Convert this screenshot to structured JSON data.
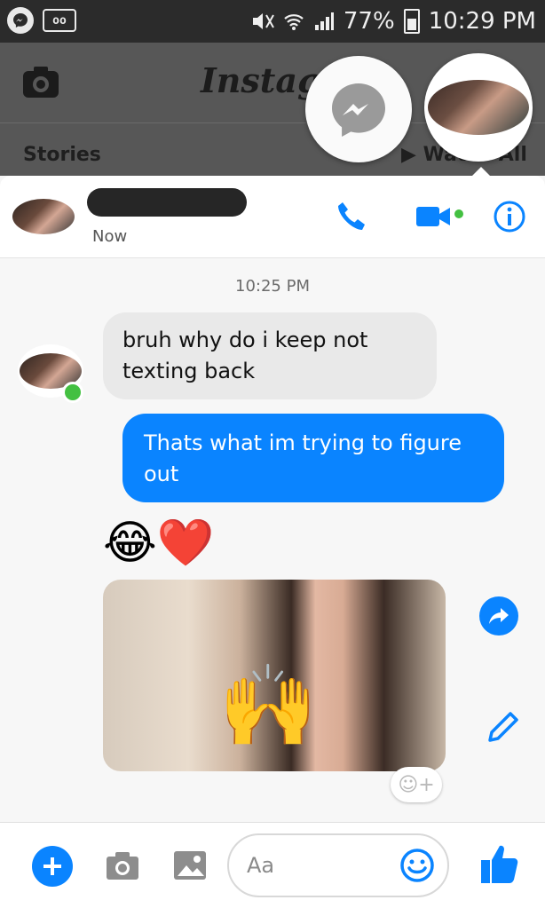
{
  "status_bar": {
    "voicemail_label": "oo",
    "battery": "77%",
    "time": "10:29 PM"
  },
  "instagram_bg": {
    "logo": "Instagram",
    "stories_label": "Stories",
    "watch_all_label": "Watch All"
  },
  "chat_header": {
    "status": "Now"
  },
  "conversation": {
    "timestamp": "10:25 PM",
    "incoming": "bruh why do i keep not texting back",
    "outgoing": "Thats what im trying to figure out",
    "emoji_message": "😂❤️",
    "photo_overlay_emoji": "🙌"
  },
  "reaction_button": "☺+",
  "composer": {
    "placeholder": "Aa"
  },
  "colors": {
    "accent": "#0a84ff",
    "online": "#43c041"
  }
}
